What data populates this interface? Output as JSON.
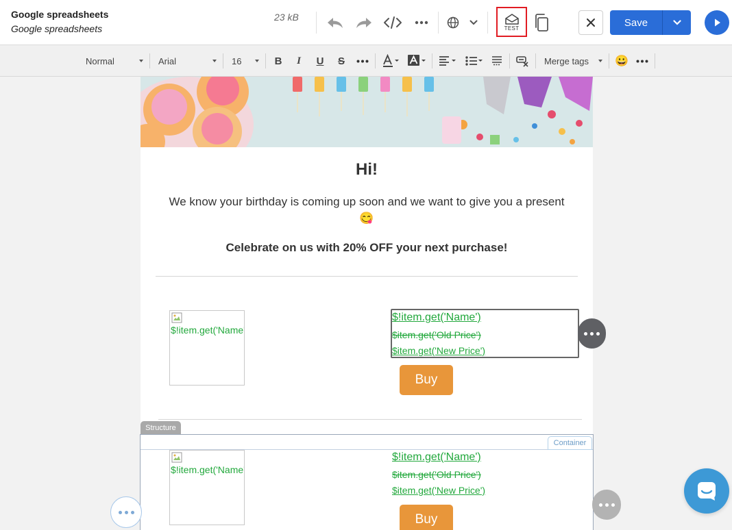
{
  "header": {
    "title": "Google spreadsheets",
    "subtitle": "Google spreadsheets",
    "size": "23 kB",
    "test_label": "TEST",
    "save_label": "Save"
  },
  "format_toolbar": {
    "paragraph_style": "Normal",
    "font_family": "Arial",
    "font_size": "16",
    "bold": "B",
    "italic": "I",
    "underline": "U",
    "strikethrough": "S",
    "merge_tags": "Merge tags",
    "emoji": "😀"
  },
  "email": {
    "greeting": "Hi!",
    "message": "We know your birthday is coming up soon and we want to give you a present",
    "message_emoji": "😋",
    "offer": "Celebrate on us with 20% OFF your next purchase!",
    "products": [
      {
        "image_alt": "$!item.get('Name')",
        "name": "$!item.get('Name')",
        "old_price": "$item.get('Old Price')",
        "new_price": "$item.get('New Price')",
        "buy_label": "Buy"
      },
      {
        "image_alt": "$!item.get('Name')",
        "name": "$!item.get('Name')",
        "old_price": "$item.get('Old Price')",
        "new_price": "$item.get('New Price')",
        "buy_label": "Buy"
      }
    ]
  },
  "editor": {
    "structure_label": "Structure",
    "container_label": "Container"
  },
  "colors": {
    "accent_blue": "#2a6dd8",
    "buy_orange": "#e8963a",
    "link_green": "#22a83c",
    "test_highlight": "#e11b22",
    "chat_blue": "#3d99d6"
  }
}
